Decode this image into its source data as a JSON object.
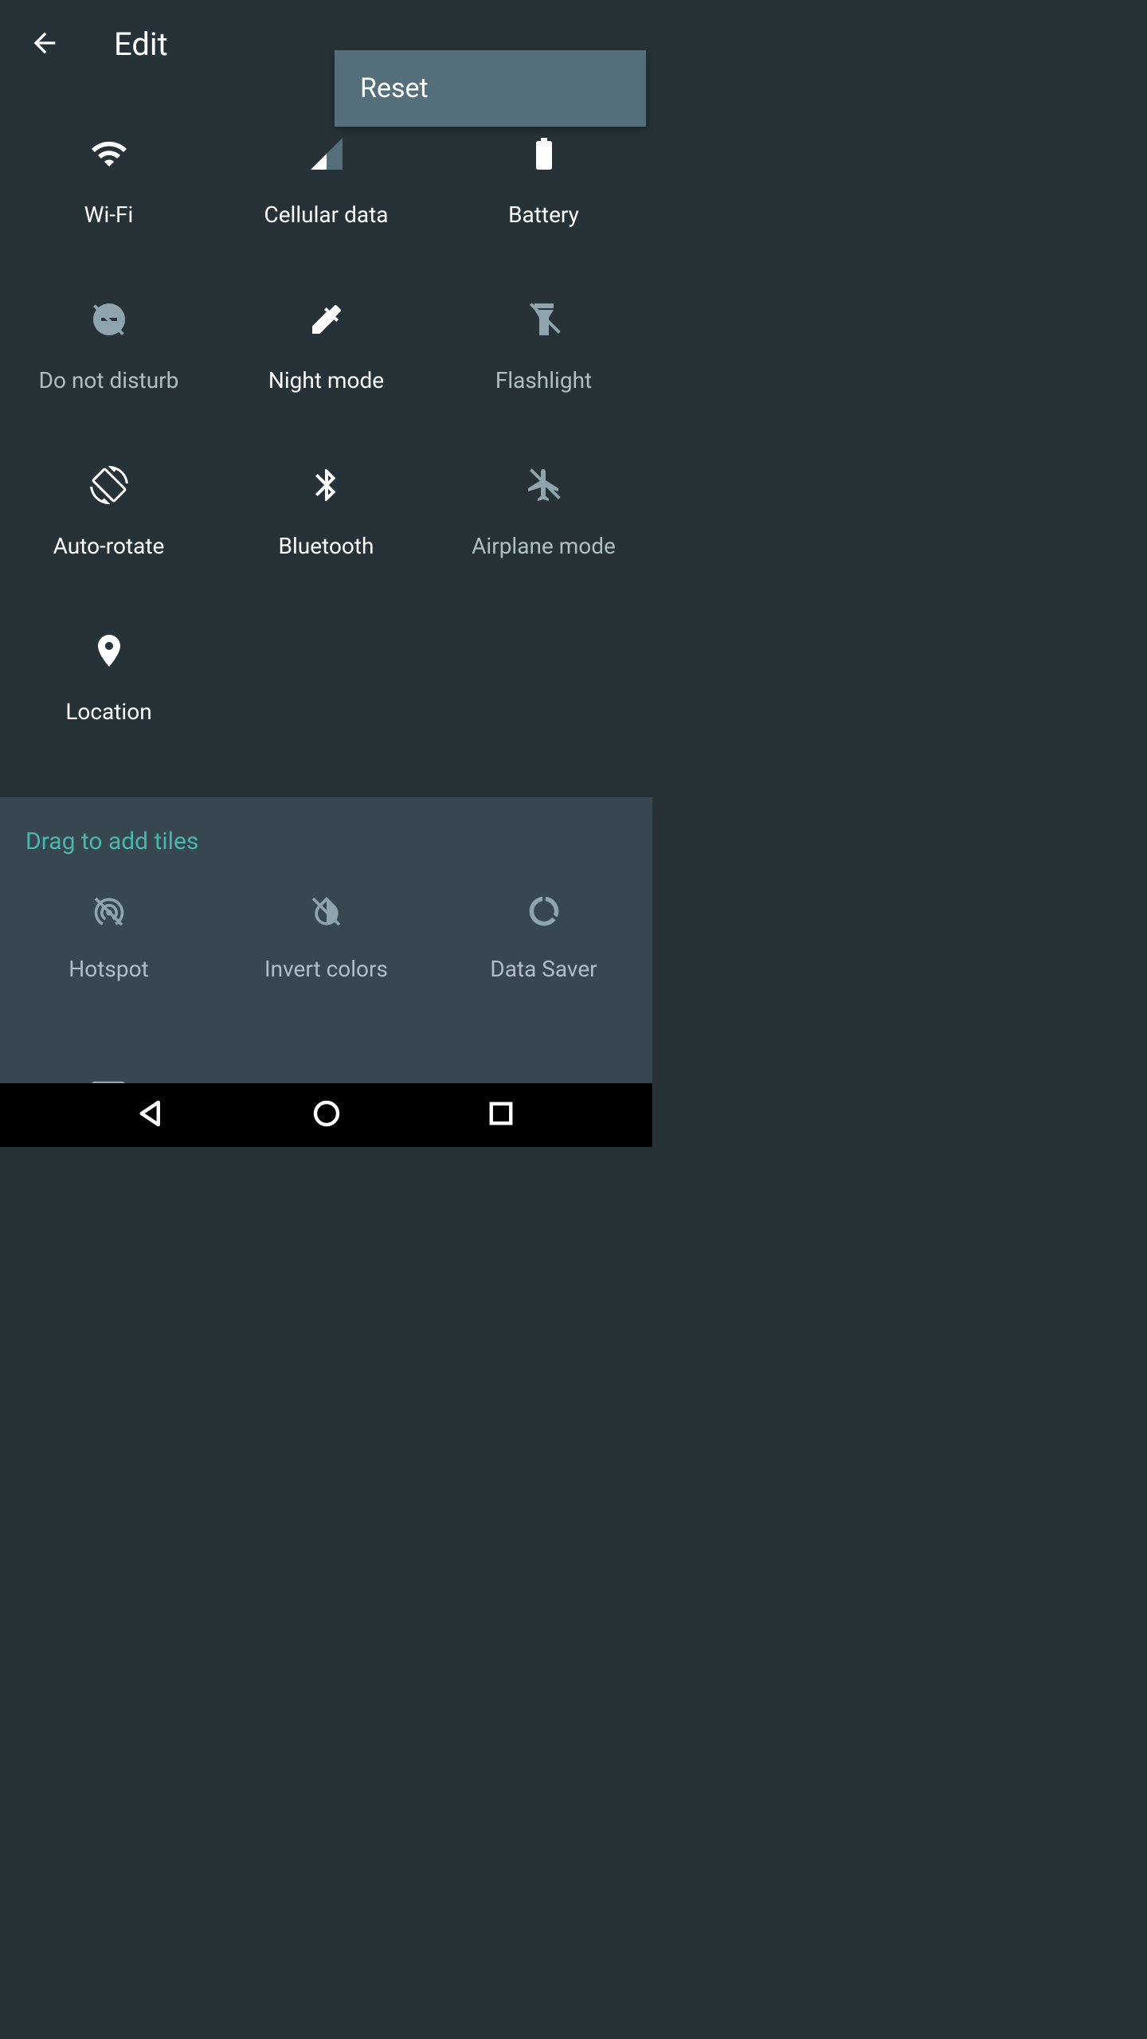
{
  "toolbar": {
    "title": "Edit",
    "reset_label": "Reset"
  },
  "active_tiles": [
    {
      "id": "wifi",
      "label": "Wi-Fi",
      "icon": "wifi"
    },
    {
      "id": "cellular",
      "label": "Cellular data",
      "icon": "signal"
    },
    {
      "id": "battery",
      "label": "Battery",
      "icon": "battery"
    },
    {
      "id": "dnd",
      "label": "Do not disturb",
      "icon": "dnd-off",
      "dim": true
    },
    {
      "id": "night",
      "label": "Night mode",
      "icon": "eyedropper"
    },
    {
      "id": "flashlight",
      "label": "Flashlight",
      "icon": "flashlight-off",
      "dim": true
    },
    {
      "id": "autorotate",
      "label": "Auto-rotate",
      "icon": "rotate"
    },
    {
      "id": "bluetooth",
      "label": "Bluetooth",
      "icon": "bluetooth"
    },
    {
      "id": "airplane",
      "label": "Airplane mode",
      "icon": "airplane-off",
      "dim": true
    },
    {
      "id": "location",
      "label": "Location",
      "icon": "pin"
    }
  ],
  "drag_section": {
    "header": "Drag to add tiles",
    "tiles": [
      {
        "id": "hotspot",
        "label": "Hotspot",
        "icon": "hotspot-off"
      },
      {
        "id": "invert",
        "label": "Invert colors",
        "icon": "invert-off"
      },
      {
        "id": "datasaver",
        "label": "Data Saver",
        "icon": "datasaver"
      }
    ]
  }
}
